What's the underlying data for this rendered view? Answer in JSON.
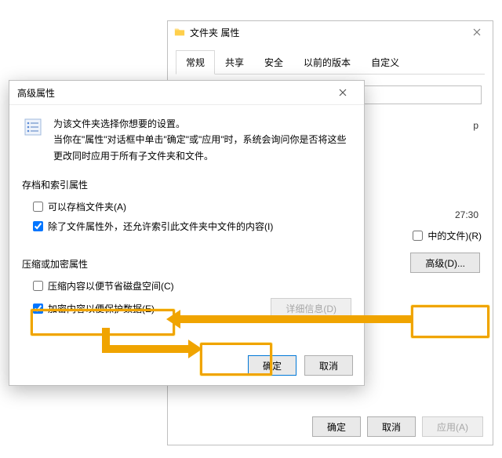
{
  "props": {
    "title": "文件夹 属性",
    "tabs": [
      "常规",
      "共享",
      "安全",
      "以前的版本",
      "自定义"
    ],
    "ext_text": "p",
    "time_text": "27:30",
    "include_sub_label": "中的文件)(R)",
    "advanced_btn": "高级(D)...",
    "ok": "确定",
    "cancel": "取消",
    "apply": "应用(A)"
  },
  "adv": {
    "window_title": "高级属性",
    "intro_line1": "为该文件夹选择你想要的设置。",
    "intro_line2": "当你在\"属性\"对话框中单击\"确定\"或\"应用\"时，系统会询问你是否将这些更改同时应用于所有子文件夹和文件。",
    "group_archive": "存档和索引属性",
    "chk_archive": "可以存档文件夹(A)",
    "chk_index": "除了文件属性外，还允许索引此文件夹中文件的内容(I)",
    "group_compress": "压缩或加密属性",
    "chk_compress": "压缩内容以便节省磁盘空间(C)",
    "chk_encrypt": "加密内容以便保护数据(E)",
    "details_btn": "详细信息(D)",
    "ok": "确定",
    "cancel": "取消",
    "checked": {
      "archive": false,
      "index": true,
      "compress": false,
      "encrypt": true
    }
  }
}
